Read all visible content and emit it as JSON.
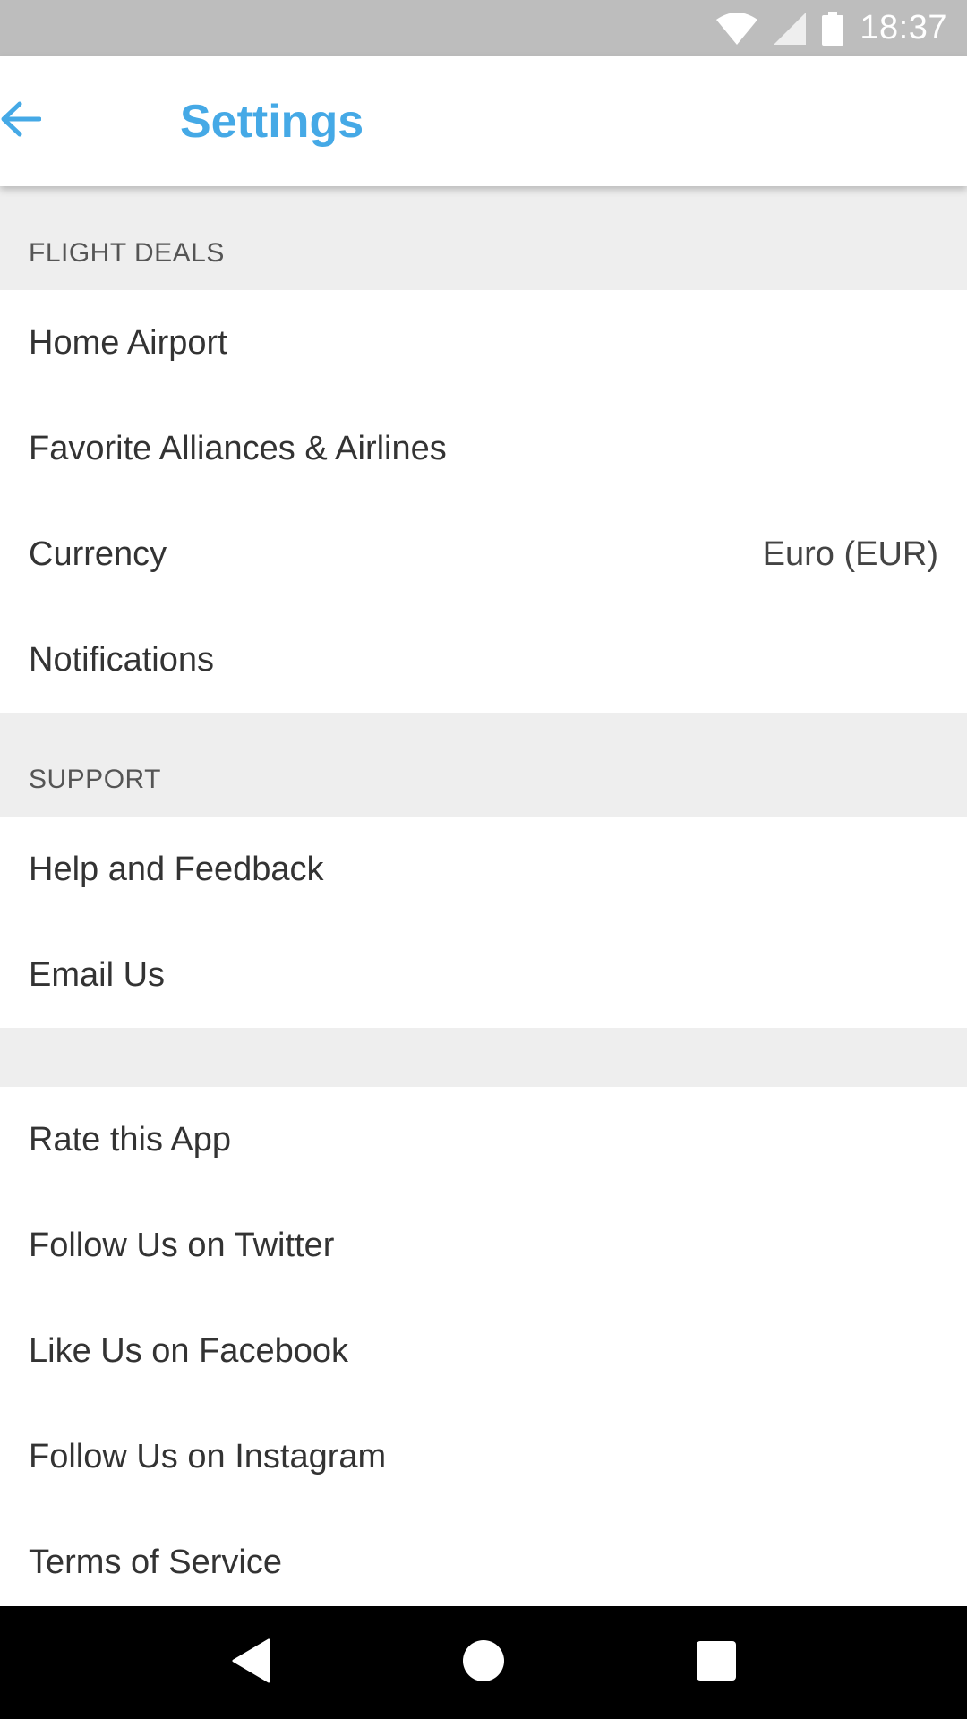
{
  "status_bar": {
    "time": "18:37",
    "icons": [
      "wifi-icon",
      "signal-icon",
      "battery-icon"
    ]
  },
  "app_bar": {
    "back_icon": "arrow-left-icon",
    "title": "Settings",
    "accent_color": "#45a9e6"
  },
  "sections": {
    "flight_deals": {
      "header": "FLIGHT DEALS",
      "items": [
        {
          "label": "Home Airport"
        },
        {
          "label": "Favorite Alliances & Airlines"
        },
        {
          "label": "Currency",
          "value": "Euro (EUR)"
        },
        {
          "label": "Notifications"
        }
      ]
    },
    "support": {
      "header": "SUPPORT",
      "items": [
        {
          "label": "Help and Feedback"
        },
        {
          "label": "Email Us"
        }
      ]
    },
    "other": {
      "items": [
        {
          "label": "Rate this App"
        },
        {
          "label": "Follow Us on Twitter"
        },
        {
          "label": "Like Us on Facebook"
        },
        {
          "label": "Follow Us on Instagram"
        },
        {
          "label": "Terms of Service"
        }
      ]
    }
  },
  "nav_bar": {
    "icons": [
      "back-triangle-icon",
      "home-circle-icon",
      "recents-square-icon"
    ]
  }
}
